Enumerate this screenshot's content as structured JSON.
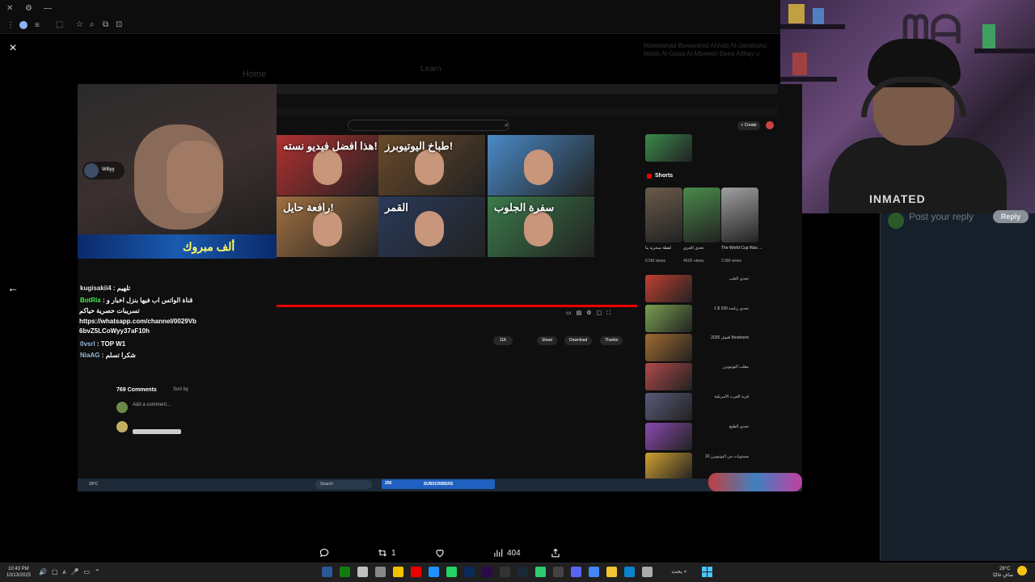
{
  "browser": {
    "close_glyph": "×",
    "window_icons": [
      "home-icon",
      "reload-icon"
    ]
  },
  "background_tweet": {
    "nav_home": "Home",
    "tab_label": "Learn",
    "header_text": "Mawwahad Bwwwahid Ahhab Al-Jahbbahd Mabb Al-Gaaa Al-Mbeeeh Beea Althay u"
  },
  "inner_stream": {
    "streamer_chip": "Wlliyy",
    "banner_text": "ألف مبروك",
    "thumbnails": [
      {
        "title": "هذا افضل فيديو نسته!",
        "bg": "#b03030"
      },
      {
        "title": "طباخ اليوتيوبرز!",
        "bg": "#6a4a2a"
      },
      {
        "title": "",
        "bg": "#4a8ac8"
      },
      {
        "title": "رافعة حايل!",
        "bg": "#a07040"
      },
      {
        "title": "القمر",
        "bg": "#2a3a5a"
      },
      {
        "title": "سفرة الجلوب",
        "bg": "#3a7a4a"
      }
    ],
    "chat": [
      {
        "name": "kugisakii4",
        "sep": " : ",
        "text": "تلهيم",
        "color": "#e8e8e8"
      },
      {
        "name": "BotRix",
        "sep": " : ",
        "text": "قناة الواتس اب فيها بنزل اخبار و",
        "color": "#5af05a"
      },
      {
        "name": "",
        "sep": "",
        "text": "تسريبات حصرية حياكم",
        "color": "#fff"
      },
      {
        "name": "",
        "sep": "",
        "text": "https://whatsapp.com/channel/0029Vb",
        "color": "#fff"
      },
      {
        "name": "",
        "sep": "",
        "text": "6bvZ5LCoWyy37aF10h",
        "color": "#fff"
      },
      {
        "name": "0vsrl",
        "sep": " : ",
        "text": "TOP W1",
        "color": "#9bd"
      },
      {
        "name": "NiaAG",
        "sep": " : ",
        "text": "شكرا تسلم",
        "color": "#9bd"
      }
    ],
    "comments_count": "769 Comments",
    "sort_by": "Sort by",
    "add_comment": "Add a comment...",
    "actions": [
      "Share",
      "Download",
      "Thanks"
    ],
    "like_count": "11K",
    "shorts_label": "Shorts",
    "shorts": [
      {
        "title": "لقطة سحرية ما",
        "views": "6.5M views",
        "bg": "#6a5a4a"
      },
      {
        "title": "تحدي الجري",
        "views": "462K views",
        "bg": "#4a8a4a"
      },
      {
        "title": "The World Cup Was ...",
        "views": "2.5M views",
        "bg": "#a0a0a0"
      }
    ],
    "side_videos": [
      {
        "title": "تحدي العلب",
        "bg": "#c04030"
      },
      {
        "title": "تحدي رياضة 100 $ 1",
        "bg": "#7aa050"
      },
      {
        "title": "افضل 2025 Ibraheem",
        "bg": "#a06a30"
      },
      {
        "title": "مقلب اليوتيوبرز",
        "bg": "#b04a4a"
      },
      {
        "title": "قرية الغرب الأمريكية",
        "bg": "#5a5a7a"
      },
      {
        "title": "تحدي الطيخ",
        "bg": "#8a4ab0"
      },
      {
        "title": "10 مستويات من اليوتيوبرز",
        "bg": "#d0a030"
      }
    ],
    "subscribers_bar": "SUBSCRIBERS",
    "subscribers_count": "256",
    "search_label": "Search",
    "weather": "29°C"
  },
  "reply_box": {
    "placeholder": "Post your reply",
    "button": "Reply"
  },
  "tweet_actions": {
    "reply_count": "",
    "retweet_count": "1",
    "like_count": "",
    "views_count": "404"
  },
  "taskbar": {
    "time": "10:43 PM",
    "date": "10/13/2025",
    "search_label": "بحث",
    "weather_temp": "28°C",
    "weather_desc": "صافٍ غالبًا",
    "apps": [
      {
        "name": "word-icon",
        "color": "#2b5797"
      },
      {
        "name": "xbox-icon",
        "color": "#107c10"
      },
      {
        "name": "calendar-icon",
        "color": "#c0c0c0"
      },
      {
        "name": "usb-icon",
        "color": "#888"
      },
      {
        "name": "notes-icon",
        "color": "#f2c200"
      },
      {
        "name": "youtube-icon",
        "color": "#e00"
      },
      {
        "name": "photos-icon",
        "color": "#1e90ff"
      },
      {
        "name": "whatsapp-icon",
        "color": "#25d366"
      },
      {
        "name": "photoshop-icon",
        "color": "#0a2a5a"
      },
      {
        "name": "premiere-icon",
        "color": "#2a0a4a"
      },
      {
        "name": "capcut-icon",
        "color": "#333"
      },
      {
        "name": "steam-icon",
        "color": "#1b2838"
      },
      {
        "name": "green-app-icon",
        "color": "#2ecc71"
      },
      {
        "name": "obs-icon",
        "color": "#444"
      },
      {
        "name": "discord-icon",
        "color": "#5865f2"
      },
      {
        "name": "chrome-icon",
        "color": "#4285f4"
      },
      {
        "name": "folder-icon",
        "color": "#f4c430"
      },
      {
        "name": "edge-icon",
        "color": "#0a84d0"
      },
      {
        "name": "explorer-icon",
        "color": "#aaa"
      }
    ]
  }
}
